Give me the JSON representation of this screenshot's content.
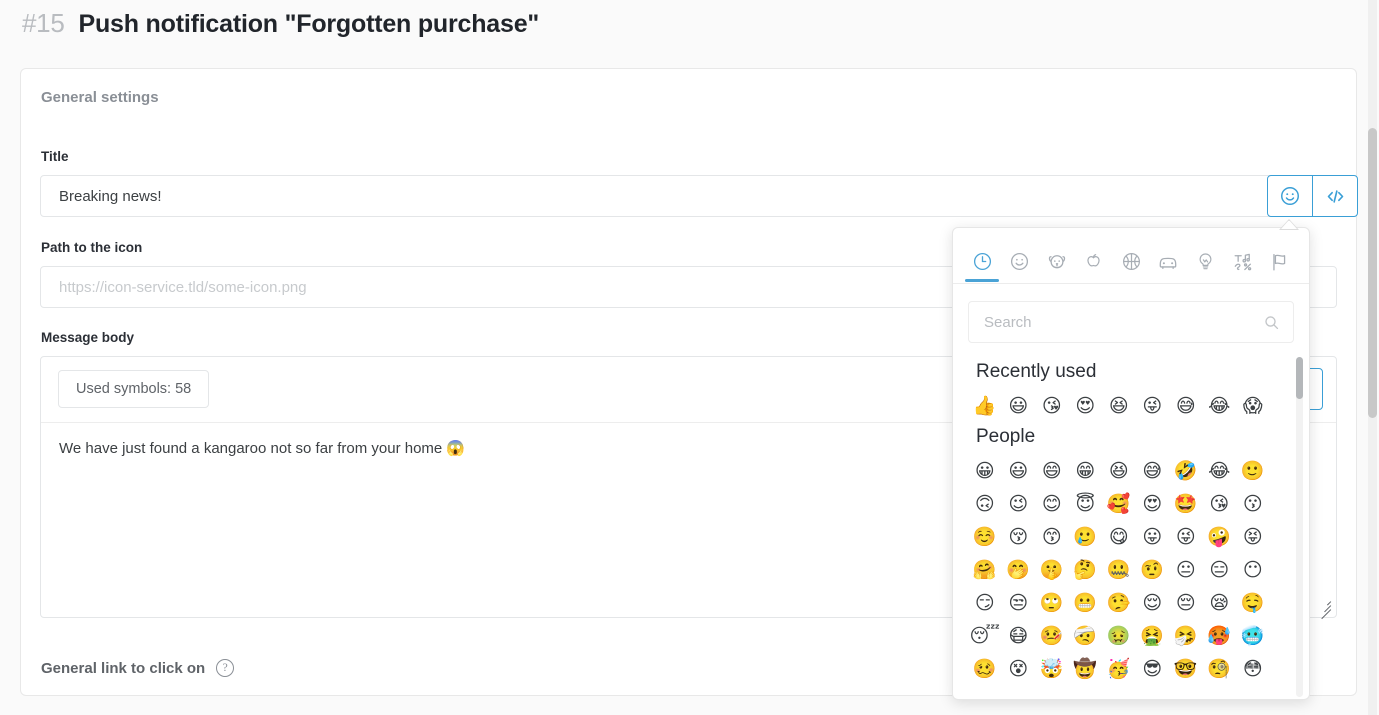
{
  "header": {
    "number": "#15",
    "title": "Push notification \"Forgotten purchase\""
  },
  "card": {
    "section_title": "General settings",
    "title_field": {
      "label": "Title",
      "value": "Breaking news!",
      "emoji_button_icon": "smiley-face-icon",
      "code_button_label": "</>"
    },
    "icon_path_field": {
      "label": "Path to the icon",
      "value": "",
      "placeholder": "https://icon-service.tld/some-icon.png"
    },
    "message_body": {
      "label": "Message body",
      "symbols_badge": "Used symbols: 58",
      "code_button_label": "</>",
      "value": "We have just found a kangaroo not so far from your home 😱"
    },
    "general_link": {
      "label": "General link to click on",
      "help_icon": "question-mark-icon",
      "help_glyph": "?"
    }
  },
  "emoji_picker": {
    "tabs": [
      {
        "name": "recently-used",
        "icon": "clock-icon",
        "active": true
      },
      {
        "name": "people",
        "icon": "smiley-icon",
        "active": false
      },
      {
        "name": "nature",
        "icon": "dog-icon",
        "active": false
      },
      {
        "name": "food",
        "icon": "apple-icon",
        "active": false
      },
      {
        "name": "activity",
        "icon": "basketball-icon",
        "active": false
      },
      {
        "name": "travel",
        "icon": "car-icon",
        "active": false
      },
      {
        "name": "objects",
        "icon": "lightbulb-icon",
        "active": false
      },
      {
        "name": "symbols",
        "icon": "symbols-icon",
        "active": false
      },
      {
        "name": "flags",
        "icon": "flag-icon",
        "active": false
      }
    ],
    "search": {
      "placeholder": "Search",
      "value": "",
      "icon": "search-icon"
    },
    "groups": [
      {
        "title": "Recently used",
        "rows": [
          [
            "👍",
            "😃",
            "😘",
            "😍",
            "😆",
            "😜",
            "😅",
            "😂",
            "😱"
          ]
        ]
      },
      {
        "title": "People",
        "rows": [
          [
            "😀",
            "😃",
            "😄",
            "😁",
            "😆",
            "😅",
            "🤣",
            "😂",
            "🙂"
          ],
          [
            "🙃",
            "😉",
            "😊",
            "😇",
            "🥰",
            "😍",
            "🤩",
            "😘",
            "😗"
          ],
          [
            "☺️",
            "😚",
            "😙",
            "🥲",
            "😋",
            "😛",
            "😜",
            "🤪",
            "😝"
          ],
          [
            "🤗",
            "🤭",
            "🤫",
            "🤔",
            "🤐",
            "🤨",
            "😐",
            "😑",
            "😶"
          ],
          [
            "😏",
            "😒",
            "🙄",
            "😬",
            "🤥",
            "😌",
            "😔",
            "😪",
            "🤤"
          ],
          [
            "😴",
            "😷",
            "🤒",
            "🤕",
            "🤢",
            "🤮",
            "🤧",
            "🥵",
            "🥶"
          ],
          [
            "🥴",
            "😵",
            "🤯",
            "🤠",
            "🥳",
            "😎",
            "🤓",
            "🧐",
            "😳"
          ]
        ]
      }
    ]
  },
  "colors": {
    "accent": "#3a9fd6",
    "page_bg": "#fafafa",
    "card_bg": "#ffffff",
    "text": "#3c4043",
    "muted": "#8a8f96"
  }
}
